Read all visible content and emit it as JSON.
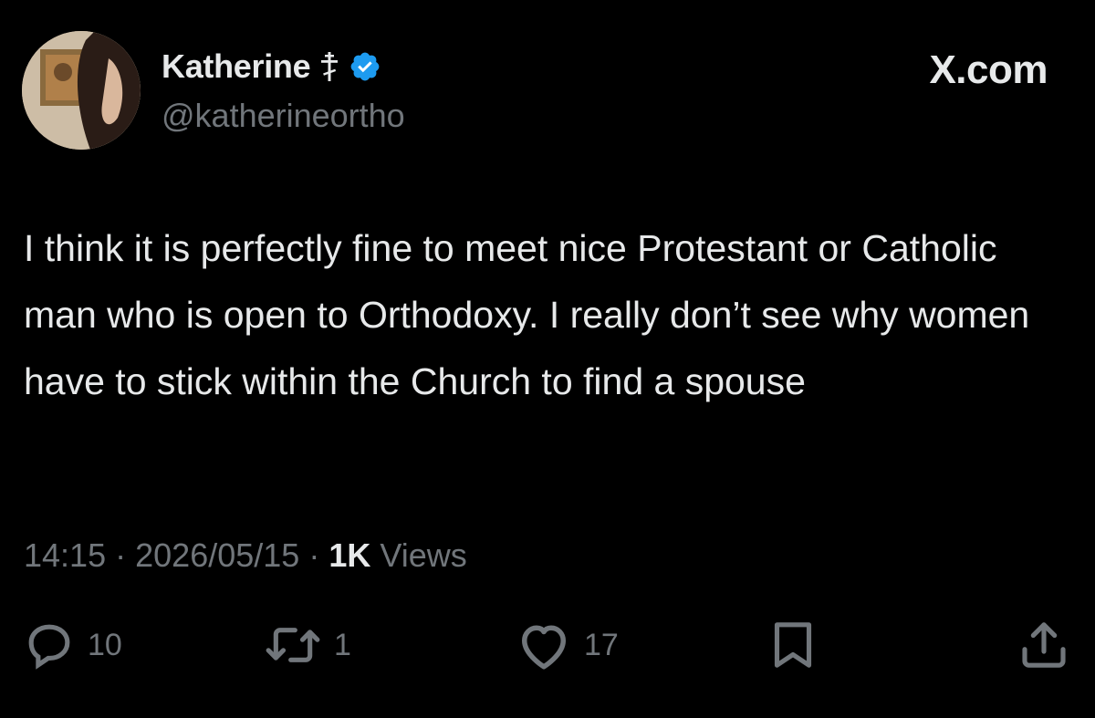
{
  "author": {
    "display_name": "Katherine",
    "handle": "@katherineortho",
    "verified": true,
    "badge_icon": "orthodox-cross-icon",
    "verified_color": "#1d9bf0"
  },
  "site_logo": "X.com",
  "tweet": {
    "text": "I think it is perfectly fine to meet nice Protestant or Catholic man who is open to Orthodoxy. I really don’t see why women have to stick within the Church to find a spouse"
  },
  "meta": {
    "time": "14:15",
    "separator": "·",
    "date": "2026/05/15",
    "views_count": "1K",
    "views_label": "Views"
  },
  "actions": {
    "replies": {
      "icon": "reply-icon",
      "count": "10"
    },
    "reposts": {
      "icon": "repost-icon",
      "count": "1"
    },
    "likes": {
      "icon": "heart-icon",
      "count": "17"
    },
    "bookmark": {
      "icon": "bookmark-icon"
    },
    "share": {
      "icon": "share-icon"
    }
  },
  "colors": {
    "background": "#000000",
    "primary_text": "#e7e9ea",
    "secondary_text": "#71767b"
  }
}
